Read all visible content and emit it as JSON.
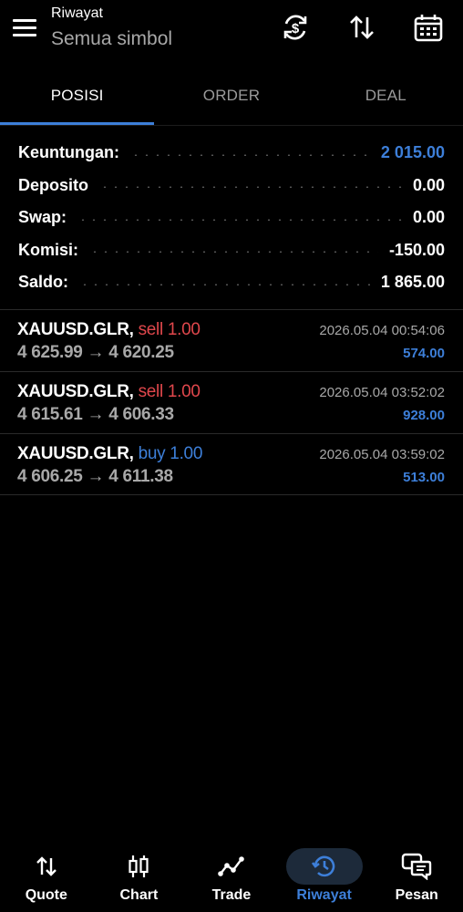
{
  "header": {
    "title": "Riwayat",
    "subtitle": "Semua simbol",
    "icons": [
      "menu-icon",
      "currency-sync-icon",
      "sort-icon",
      "calendar-icon"
    ]
  },
  "tabs": [
    {
      "label": "POSISI",
      "active": true
    },
    {
      "label": "ORDER",
      "active": false
    },
    {
      "label": "DEAL",
      "active": false
    }
  ],
  "summary": [
    {
      "label": "Keuntungan:",
      "value": "2 015.00",
      "color": "#3d7fd9"
    },
    {
      "label": "Deposito",
      "value": "0.00"
    },
    {
      "label": "Swap:",
      "value": "0.00"
    },
    {
      "label": "Komisi:",
      "value": "-150.00"
    },
    {
      "label": "Saldo:",
      "value": "1 865.00"
    }
  ],
  "deals": [
    {
      "symbol": "XAUUSD.GLR,",
      "side": "sell 1.00",
      "type": "sell",
      "prices": "4 625.99 → 4 620.25",
      "time": "2026.05.04 00:54:06",
      "profit": "574.00"
    },
    {
      "symbol": "XAUUSD.GLR,",
      "side": "sell 1.00",
      "type": "sell",
      "prices": "4 615.61 → 4 606.33",
      "time": "2026.05.04 03:52:02",
      "profit": "928.00"
    },
    {
      "symbol": "XAUUSD.GLR,",
      "side": "buy 1.00",
      "type": "buy",
      "prices": "4 606.25 → 4 611.38",
      "time": "2026.05.04 03:59:02",
      "profit": "513.00"
    }
  ],
  "nav": [
    {
      "label": "Quote",
      "icon": "quote-arrows-icon",
      "active": false
    },
    {
      "label": "Chart",
      "icon": "candlestick-icon",
      "active": false
    },
    {
      "label": "Trade",
      "icon": "trade-line-icon",
      "active": false
    },
    {
      "label": "Riwayat",
      "icon": "history-icon",
      "active": true
    },
    {
      "label": "Pesan",
      "icon": "messages-icon",
      "active": false
    }
  ],
  "colors": {
    "accent": "#3d7fd9",
    "sell": "#e0474c",
    "background": "#000000"
  }
}
